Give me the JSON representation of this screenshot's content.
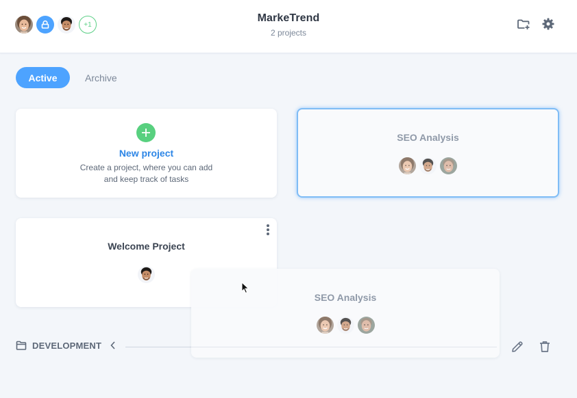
{
  "header": {
    "title": "MarkeTrend",
    "subtitle": "2 projects",
    "members": [
      {
        "name": "member-woman-avatar",
        "type": "photo"
      },
      {
        "name": "member-locked-avatar",
        "type": "icon",
        "icon": "lock-person-icon"
      },
      {
        "name": "member-man-avatar",
        "type": "photo"
      },
      {
        "name": "more-members-badge",
        "type": "count",
        "label": "+1"
      }
    ],
    "actions": [
      {
        "name": "new-folder-button",
        "icon": "folder-plus-icon"
      },
      {
        "name": "settings-button",
        "icon": "gear-icon"
      }
    ]
  },
  "tabs": [
    {
      "label": "Active",
      "selected": true
    },
    {
      "label": "Archive",
      "selected": false
    }
  ],
  "new_project_card": {
    "icon": "plus-icon",
    "title": "New project",
    "description_line1": "Create a project, where you can add",
    "description_line2": "and keep track of tasks"
  },
  "projects": [
    {
      "title": "SEO Analysis",
      "state": "drop-target-highlighted",
      "members": [
        "woman",
        "man-dark-hair",
        "man-grey-hair"
      ]
    },
    {
      "title": "Welcome Project",
      "state": "normal",
      "members": [
        "man-dark-hair"
      ],
      "menu_icon": "more-vertical-icon"
    },
    {
      "title": "SEO Analysis",
      "state": "dragging-preview",
      "members": [
        "woman",
        "man-dark-hair",
        "man-grey-hair"
      ]
    }
  ],
  "group": {
    "icon": "folder-icon",
    "label": "DEVELOPMENT",
    "collapse_icon": "chevron-left-icon",
    "edit_icon": "pencil-icon",
    "delete_icon": "trash-icon"
  },
  "colors": {
    "accent": "#4da3ff",
    "success": "#58d07f",
    "link": "#2d86e6",
    "background": "#f3f6fa",
    "text_dark": "#2f3744",
    "text_muted": "#7b8798"
  }
}
